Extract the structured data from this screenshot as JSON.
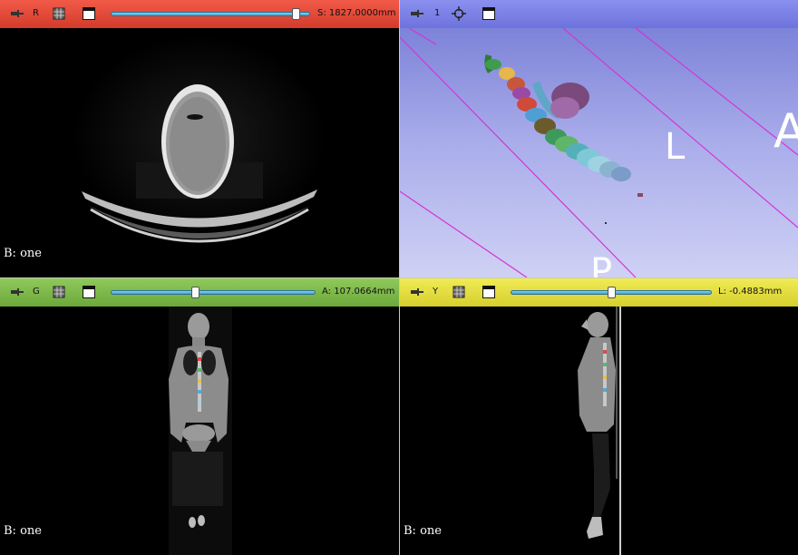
{
  "views": {
    "red": {
      "letter": "R",
      "readout": "S: 1827.0000mm",
      "slider_fraction": 0.93,
      "corner_label": "B: one",
      "color": "#e0483a"
    },
    "threed": {
      "letter": "1",
      "orientation_labels": [
        "L",
        "A",
        "P"
      ],
      "color": "#7e84e4"
    },
    "green": {
      "letter": "G",
      "readout": "A: 107.0664mm",
      "slider_fraction": 0.42,
      "corner_label": "B: one",
      "color": "#7dba4b"
    },
    "yellow": {
      "letter": "Y",
      "readout": "L: -0.4883mm",
      "slider_fraction": 0.5,
      "corner_label": "B: one",
      "color": "#e3dd3f"
    }
  },
  "icons": {
    "pin": "pin-icon",
    "layout": "slice-layout-icon",
    "window": "maximize-view-icon",
    "center": "center-view-icon"
  }
}
